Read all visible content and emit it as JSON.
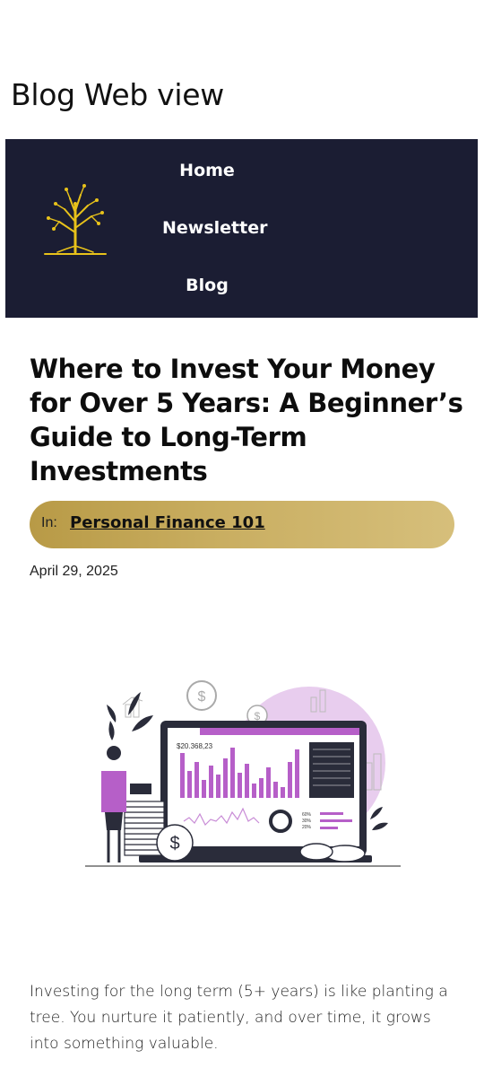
{
  "page": {
    "heading": "Blog Web view"
  },
  "nav": {
    "items": [
      {
        "label": "Home"
      },
      {
        "label": "Newsletter"
      },
      {
        "label": "Blog"
      }
    ]
  },
  "article": {
    "title": "Where to Invest Your Money for Over 5 Years: A Beginner’s Guide to Long-Term Investments",
    "category_prefix": "In:",
    "category": "Personal Finance 101",
    "date": "April 29, 2025",
    "body": "Investing for the long term (5+ years) is like planting a tree. You nurture it patiently, and over time, it grows into something valuable."
  },
  "illustration": {
    "amount": "$20.368,23",
    "stats": [
      "60%",
      "30%",
      "20%"
    ]
  },
  "colors": {
    "nav_bg": "#1b1d33",
    "accent_gold": "#c9ae61",
    "accent_purple": "#b65fc8"
  }
}
